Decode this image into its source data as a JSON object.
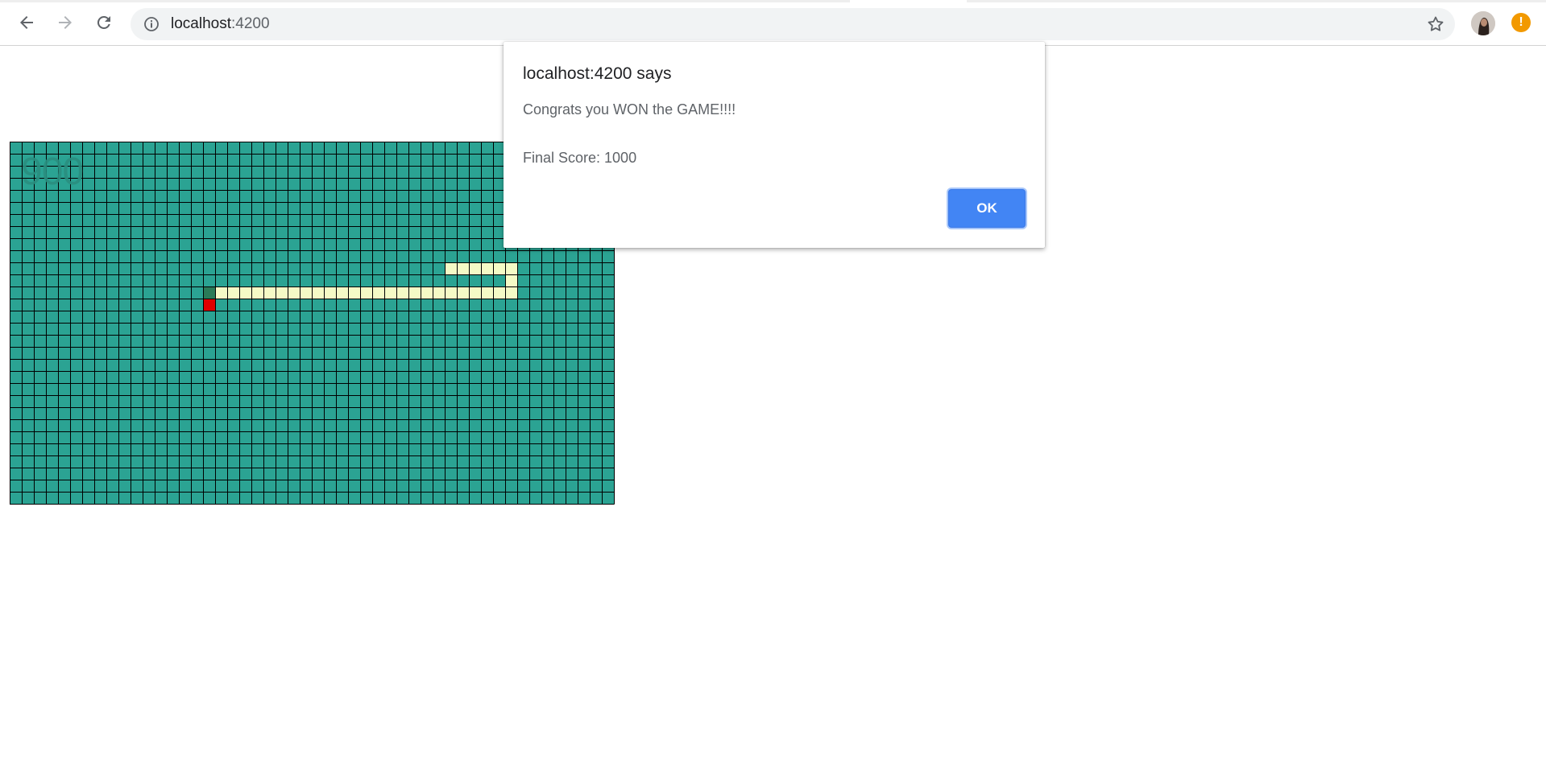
{
  "browser": {
    "url_host": "localhost",
    "url_port": ":4200",
    "icons": {
      "back": "back-arrow-icon",
      "forward": "forward-arrow-icon",
      "reload": "reload-icon",
      "info": "info-icon",
      "star": "star-icon",
      "alert": "alert-icon"
    },
    "alert_badge": "!"
  },
  "game": {
    "score": "900",
    "grid_cols": 50,
    "grid_rows": 30,
    "colors": {
      "cell": "#2ba393",
      "grid_line": "#000000",
      "snake": "#f5fac6",
      "snake_head": "#2a7a57",
      "food": "#e00000"
    },
    "snake_cells": [
      [
        17,
        12
      ],
      [
        18,
        12
      ],
      [
        19,
        12
      ],
      [
        20,
        12
      ],
      [
        21,
        12
      ],
      [
        22,
        12
      ],
      [
        23,
        12
      ],
      [
        24,
        12
      ],
      [
        25,
        12
      ],
      [
        26,
        12
      ],
      [
        27,
        12
      ],
      [
        28,
        12
      ],
      [
        29,
        12
      ],
      [
        30,
        12
      ],
      [
        31,
        12
      ],
      [
        32,
        12
      ],
      [
        33,
        12
      ],
      [
        34,
        12
      ],
      [
        35,
        12
      ],
      [
        36,
        12
      ],
      [
        37,
        12
      ],
      [
        38,
        12
      ],
      [
        39,
        12
      ],
      [
        40,
        12
      ],
      [
        41,
        12
      ],
      [
        41,
        11
      ],
      [
        41,
        10
      ],
      [
        40,
        10
      ],
      [
        39,
        10
      ],
      [
        38,
        10
      ],
      [
        37,
        10
      ],
      [
        36,
        10
      ]
    ],
    "snake_head_cell": [
      16,
      12
    ],
    "food_cell": [
      16,
      13
    ]
  },
  "dialog": {
    "title": "localhost:4200 says",
    "message": "Congrats you WON the GAME!!!!",
    "final_score": "Final Score: 1000",
    "ok_label": "OK"
  }
}
